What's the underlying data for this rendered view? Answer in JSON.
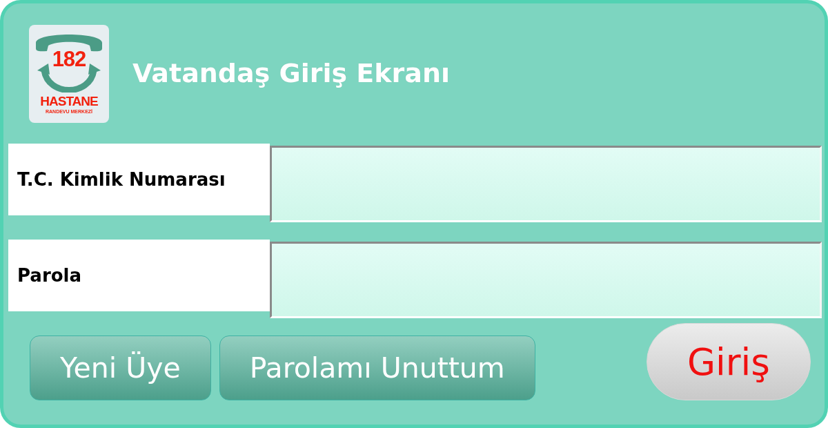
{
  "header": {
    "logo": {
      "number": "182",
      "name": "HASTANE",
      "subtitle": "RANDEVU MERKEZİ"
    },
    "title": "Vatandaş Giriş Ekranı"
  },
  "fields": [
    {
      "label": "T.C. Kimlik Numarası"
    },
    {
      "label": "Parola"
    }
  ],
  "buttons": [
    {
      "label": "Yeni Üye",
      "kind": "secondary"
    },
    {
      "label": "Parolamı Unuttum",
      "kind": "secondary"
    },
    {
      "label": "Giriş",
      "kind": "submit"
    }
  ]
}
